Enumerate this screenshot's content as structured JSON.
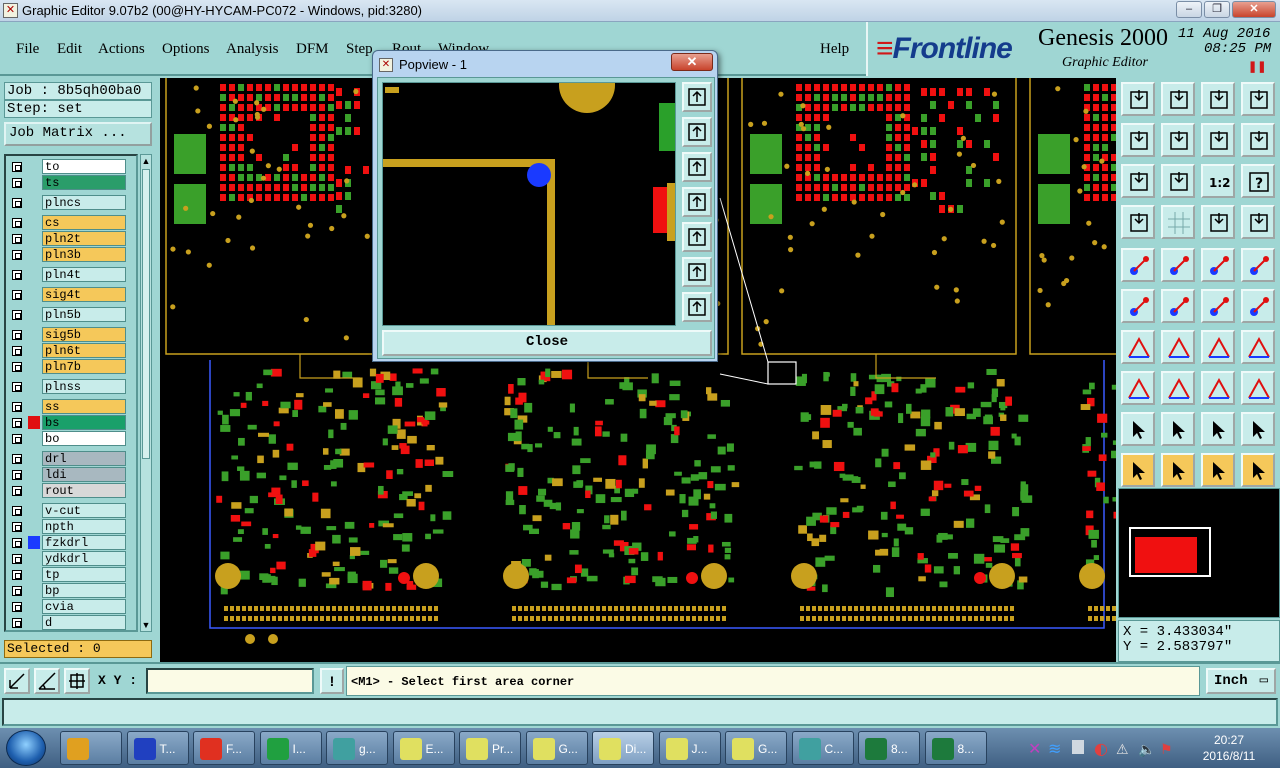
{
  "window": {
    "title": "Graphic Editor 9.07b2 (00@HY-HYCAM-PC072 - Windows, pid:3280)"
  },
  "menu": [
    "File",
    "Edit",
    "Actions",
    "Options",
    "Analysis",
    "DFM",
    "Step",
    "Rout",
    "Window",
    "Help"
  ],
  "brand": {
    "logo": "Frontline",
    "product": "Genesis 2000",
    "subtitle": "Graphic Editor",
    "date": "11 Aug 2016",
    "time": "08:25 PM"
  },
  "job": {
    "job_label": "Job : 8b5qh00ba0",
    "step_label": "Step: set",
    "matrix_button": "Job Matrix ..."
  },
  "layers": [
    {
      "name": "to",
      "color": "#ffffff",
      "swatch": ""
    },
    {
      "name": "ts",
      "color": "#2a9d6a",
      "swatch": ""
    },
    {
      "name": "plncs",
      "color": "#c8ecea",
      "swatch": ""
    },
    {
      "name": "cs",
      "color": "#f5c85a",
      "swatch": ""
    },
    {
      "name": "pln2t",
      "color": "#f5c85a",
      "swatch": ""
    },
    {
      "name": "pln3b",
      "color": "#f5c85a",
      "swatch": ""
    },
    {
      "name": "pln4t",
      "color": "#c8ecea",
      "swatch": ""
    },
    {
      "name": "sig4t",
      "color": "#f5c85a",
      "swatch": ""
    },
    {
      "name": "pln5b",
      "color": "#c8ecea",
      "swatch": ""
    },
    {
      "name": "sig5b",
      "color": "#f5c85a",
      "swatch": ""
    },
    {
      "name": "pln6t",
      "color": "#f5c85a",
      "swatch": ""
    },
    {
      "name": "pln7b",
      "color": "#f5c85a",
      "swatch": ""
    },
    {
      "name": "plnss",
      "color": "#c8ecea",
      "swatch": ""
    },
    {
      "name": "ss",
      "color": "#f5c85a",
      "swatch": ""
    },
    {
      "name": "bs",
      "color": "#1aa06a",
      "swatch": "#e01010"
    },
    {
      "name": "bo",
      "color": "#ffffff",
      "swatch": ""
    },
    {
      "name": "drl",
      "color": "#a8b8c0",
      "swatch": ""
    },
    {
      "name": "ldi",
      "color": "#a8b8c0",
      "swatch": ""
    },
    {
      "name": "rout",
      "color": "#d8d8d8",
      "swatch": ""
    },
    {
      "name": "v-cut",
      "color": "#c8ecea",
      "swatch": ""
    },
    {
      "name": "npth",
      "color": "#c8ecea",
      "swatch": ""
    },
    {
      "name": "fzkdrl",
      "color": "#c8ecea",
      "swatch": "#1a3aff"
    },
    {
      "name": "ydkdrl",
      "color": "#c8ecea",
      "swatch": ""
    },
    {
      "name": "tp",
      "color": "#c8ecea",
      "swatch": ""
    },
    {
      "name": "bp",
      "color": "#c8ecea",
      "swatch": ""
    },
    {
      "name": "cvia",
      "color": "#c8ecea",
      "swatch": ""
    },
    {
      "name": "d",
      "color": "#c8ecea",
      "swatch": ""
    }
  ],
  "selection": {
    "selected_label": "Selected : 0"
  },
  "coords": {
    "x": "X = 3.433034\"",
    "y": "Y = 2.583797\""
  },
  "input": {
    "xy_label": "X Y :",
    "xy_value": "",
    "exclaim": "!"
  },
  "prompt": {
    "text": "<M1> - Select first area corner"
  },
  "units": {
    "label": "Inch"
  },
  "popview": {
    "title": "Popview - 1",
    "close_label": "Close"
  },
  "taskbar": {
    "tasks": [
      {
        "label": "",
        "icon": "shell-icon",
        "color": "#e0a020"
      },
      {
        "label": "T...",
        "icon": "floppy-icon",
        "color": "#2040c0"
      },
      {
        "label": "F...",
        "icon": "genesis-g-icon",
        "color": "#e03020"
      },
      {
        "label": "I...",
        "icon": "frontline-f-icon",
        "color": "#20a040"
      },
      {
        "label": "g...",
        "icon": "eye-icon",
        "color": "#40a0a0"
      },
      {
        "label": "E...",
        "icon": "editor-icon",
        "color": "#e0e060"
      },
      {
        "label": "Pr...",
        "icon": "editor-icon",
        "color": "#e0e060"
      },
      {
        "label": "G...",
        "icon": "editor-icon",
        "color": "#e0e060"
      },
      {
        "label": "Di...",
        "icon": "editor-icon",
        "color": "#e0e060"
      },
      {
        "label": "J...",
        "icon": "editor-icon",
        "color": "#e0e060"
      },
      {
        "label": "G...",
        "icon": "editor-icon",
        "color": "#e0e060"
      },
      {
        "label": "C...",
        "icon": "eye-icon",
        "color": "#40a0a0"
      },
      {
        "label": "8...",
        "icon": "excel-icon",
        "color": "#1d7a3c"
      },
      {
        "label": "8...",
        "icon": "excel-icon",
        "color": "#1d7a3c"
      }
    ],
    "clock_time": "20:27",
    "clock_date": "2016/8/11"
  }
}
